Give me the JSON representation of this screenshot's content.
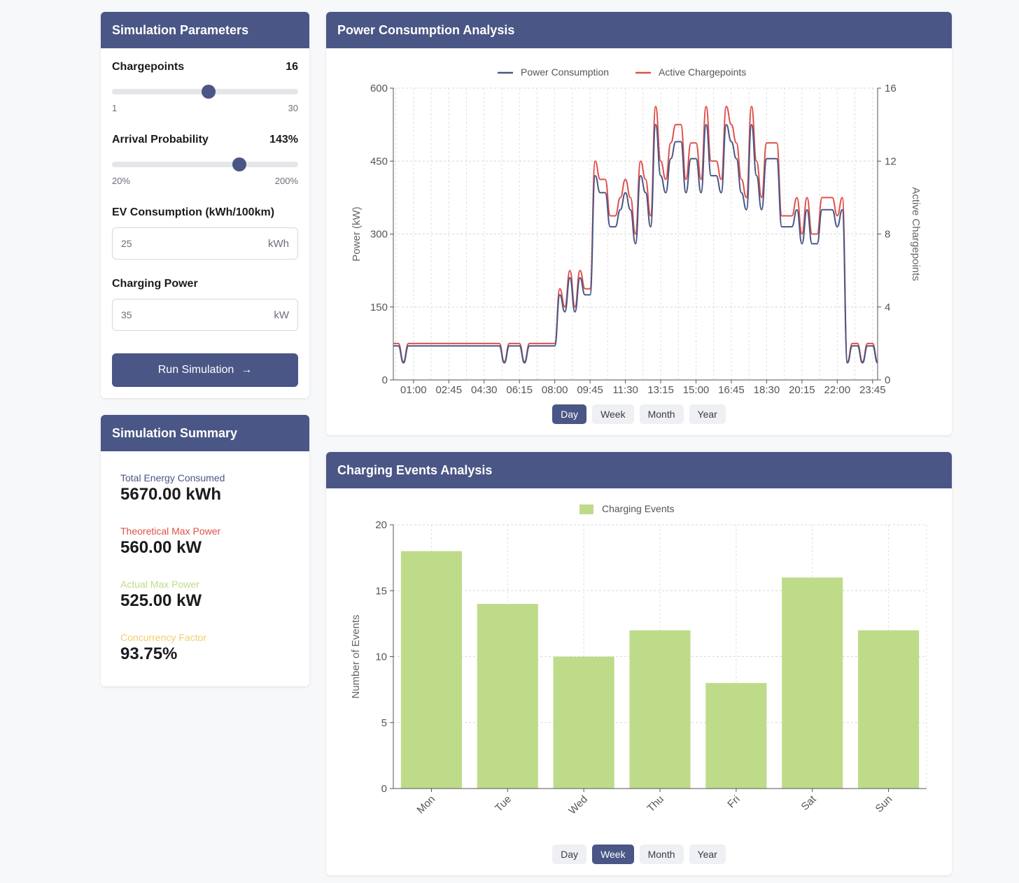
{
  "params": {
    "title": "Simulation Parameters",
    "chargepoints": {
      "label": "Chargepoints",
      "value_text": "16",
      "value": 16,
      "min": 1,
      "max": 30,
      "min_label": "1",
      "max_label": "30"
    },
    "arrival": {
      "label": "Arrival Probability",
      "value_text": "143%",
      "value": 143,
      "min": 20,
      "max": 200,
      "min_label": "20%",
      "max_label": "200%"
    },
    "ev_consumption": {
      "label": "EV Consumption (kWh/100km)",
      "value": "25",
      "unit": "kWh"
    },
    "charging_power": {
      "label": "Charging Power",
      "value": "35",
      "unit": "kW"
    },
    "run_label": "Run Simulation"
  },
  "summary": {
    "title": "Simulation Summary",
    "stats": [
      {
        "label": "Total Energy Consumed",
        "value": "5670.00 kWh",
        "color": "#4a5685"
      },
      {
        "label": "Theoretical Max Power",
        "value": "560.00 kW",
        "color": "#e0504a"
      },
      {
        "label": "Actual Max Power",
        "value": "525.00 kW",
        "color": "#bedb8a"
      },
      {
        "label": "Concurrency Factor",
        "value": "93.75%",
        "color": "#f2cf6e"
      }
    ]
  },
  "power": {
    "title": "Power Consumption Analysis",
    "tabs": [
      "Day",
      "Week",
      "Month",
      "Year"
    ],
    "active_tab": 0
  },
  "events": {
    "title": "Charging Events Analysis",
    "tabs": [
      "Day",
      "Week",
      "Month",
      "Year"
    ],
    "active_tab": 1
  },
  "chart_data": [
    {
      "type": "line",
      "legend": [
        "Power Consumption",
        "Active Chargepoints"
      ],
      "legend_placement": "top-center",
      "ylabel": "Power (kW)",
      "y2label": "Active Chargepoints",
      "ylim": [
        0,
        600
      ],
      "y2lim": [
        0,
        16
      ],
      "yticks": [
        "0",
        "150",
        "300",
        "450",
        "600"
      ],
      "y2ticks": [
        "0",
        "4",
        "8",
        "12",
        "16"
      ],
      "xticks": [
        "01:00",
        "02:45",
        "04:30",
        "06:15",
        "08:00",
        "09:45",
        "11:30",
        "13:15",
        "15:00",
        "16:45",
        "18:30",
        "20:15",
        "22:00",
        "23:45"
      ],
      "grid": true,
      "colors": {
        "power": "#4a5685",
        "chargepoints": "#e0504a"
      },
      "x_hours": [
        0.0,
        0.25,
        0.5,
        0.75,
        1,
        2,
        3,
        4,
        5,
        5.25,
        5.5,
        5.75,
        6,
        6.25,
        6.5,
        6.75,
        7,
        7.25,
        7.5,
        7.75,
        8,
        8.25,
        8.5,
        8.75,
        9,
        9.25,
        9.5,
        9.75,
        10,
        10.25,
        10.5,
        10.75,
        11,
        11.25,
        11.5,
        11.75,
        12,
        12.25,
        12.5,
        12.75,
        13,
        13.25,
        13.5,
        13.75,
        14,
        14.25,
        14.5,
        14.75,
        15,
        15.25,
        15.5,
        15.75,
        16,
        16.25,
        16.5,
        16.75,
        17,
        17.25,
        17.5,
        17.75,
        18,
        18.25,
        18.5,
        18.75,
        19,
        19.25,
        19.5,
        19.75,
        20,
        20.25,
        20.5,
        20.75,
        21,
        21.25,
        21.5,
        21.75,
        22,
        22.25,
        22.5,
        22.75,
        23,
        23.25,
        23.5,
        23.75,
        24
      ],
      "series": [
        {
          "name": "Power Consumption",
          "axis": "left",
          "values": [
            70,
            70,
            35,
            70,
            70,
            70,
            70,
            70,
            70,
            70,
            35,
            70,
            70,
            70,
            35,
            70,
            70,
            70,
            70,
            70,
            70,
            175,
            140,
            210,
            140,
            210,
            175,
            175,
            420,
            385,
            385,
            315,
            315,
            350,
            385,
            350,
            280,
            420,
            385,
            315,
            525,
            420,
            385,
            455,
            490,
            490,
            385,
            455,
            455,
            385,
            525,
            420,
            420,
            385,
            525,
            490,
            455,
            385,
            350,
            525,
            420,
            350,
            455,
            455,
            455,
            315,
            315,
            315,
            350,
            280,
            350,
            280,
            280,
            350,
            350,
            350,
            315,
            350,
            35,
            70,
            70,
            35,
            70,
            70,
            35
          ],
          "note": "kW"
        },
        {
          "name": "Active Chargepoints",
          "axis": "right",
          "values": [
            2,
            2,
            1,
            2,
            2,
            2,
            2,
            2,
            2,
            2,
            1,
            2,
            2,
            2,
            1,
            2,
            2,
            2,
            2,
            2,
            2,
            5,
            4,
            6,
            4,
            6,
            5,
            5,
            12,
            11,
            11,
            9,
            9,
            10,
            11,
            10,
            8,
            12,
            11,
            9,
            15,
            12,
            11,
            13,
            14,
            14,
            11,
            13,
            13,
            11,
            15,
            12,
            12,
            11,
            15,
            14,
            13,
            11,
            10,
            15,
            12,
            10,
            13,
            13,
            13,
            9,
            9,
            9,
            10,
            8,
            10,
            8,
            8,
            10,
            10,
            10,
            9,
            10,
            1,
            2,
            2,
            1,
            2,
            2,
            1
          ]
        }
      ]
    },
    {
      "type": "bar",
      "legend": [
        "Charging Events"
      ],
      "legend_placement": "top-center",
      "categories": [
        "Mon",
        "Tue",
        "Wed",
        "Thu",
        "Fri",
        "Sat",
        "Sun"
      ],
      "values": [
        18,
        14,
        10,
        12,
        8,
        16,
        12
      ],
      "ylabel": "Number of Events",
      "ylim": [
        0,
        20
      ],
      "yticks": [
        "0",
        "5",
        "10",
        "15",
        "20"
      ],
      "grid": true,
      "color": "#bedb8a"
    }
  ]
}
